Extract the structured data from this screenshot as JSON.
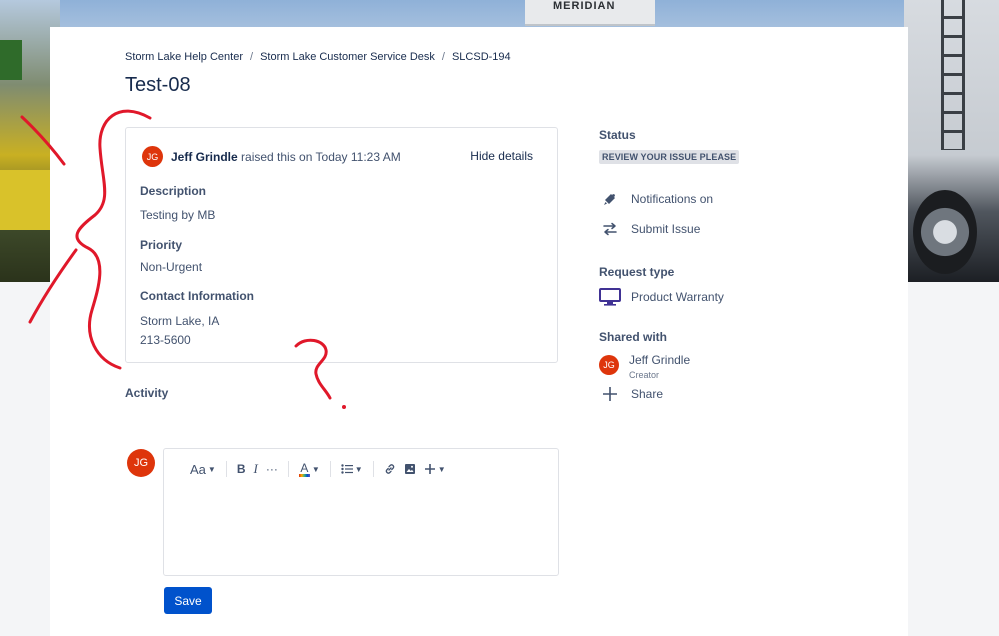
{
  "breadcrumb": {
    "items": [
      "Storm Lake Help Center",
      "Storm Lake Customer Service Desk",
      "SLCSD-194"
    ],
    "separator": "/"
  },
  "banner": {
    "sign_text": "MERIDIAN"
  },
  "request": {
    "title": "Test-08",
    "reporter_initials": "JG",
    "reporter_name": "Jeff Grindle",
    "raised_text": "raised this on Today 11:23 AM",
    "hide_details_label": "Hide details",
    "fields": {
      "description_label": "Description",
      "description_value": "Testing by MB",
      "priority_label": "Priority",
      "priority_value": "Non-Urgent",
      "contact_label": "Contact Information",
      "contact_line1": "Storm Lake, IA",
      "contact_line2": "213-5600"
    }
  },
  "activity": {
    "label": "Activity",
    "commenter_initials": "JG",
    "toolbar": {
      "text_style": "Aa",
      "bold": "B",
      "italic": "I",
      "more": "···"
    },
    "save_label": "Save"
  },
  "sidebar": {
    "status_label": "Status",
    "status_value": "REVIEW YOUR ISSUE PLEASE",
    "notifications_label": "Notifications on",
    "submit_label": "Submit Issue",
    "request_type_label": "Request type",
    "request_type_value": "Product Warranty",
    "shared_with_label": "Shared with",
    "shared_user_initials": "JG",
    "shared_user_name": "Jeff Grindle",
    "shared_user_role": "Creator",
    "share_label": "Share"
  },
  "colors": {
    "primary": "#0052cc",
    "avatar": "#de350b",
    "annotation": "#e0182a",
    "text": "#172b4d",
    "muted_text": "#42526e"
  },
  "icons": [
    "bell-icon",
    "swap-arrows-icon",
    "monitor-icon",
    "plus-icon",
    "bold-icon",
    "italic-icon",
    "text-color-icon",
    "bullet-list-icon",
    "link-icon",
    "image-icon",
    "insert-plus-icon"
  ]
}
